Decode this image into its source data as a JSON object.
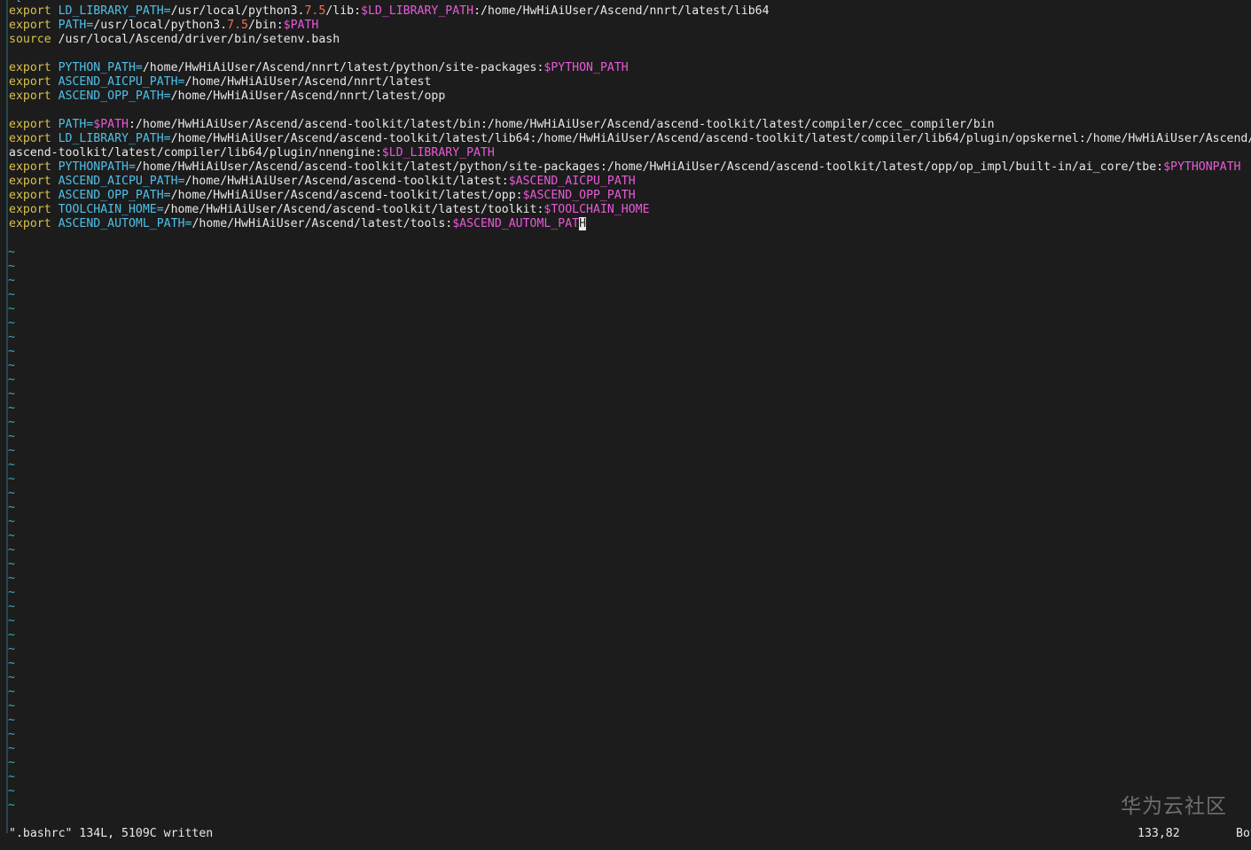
{
  "editor": {
    "lines": [
      [
        {
          "t": "^[",
          "c": "tilde"
        }
      ],
      [
        {
          "t": "export ",
          "c": "kw"
        },
        {
          "t": "LD_LIBRARY_PATH=",
          "c": "var"
        },
        {
          "t": "/usr/local/python3."
        },
        {
          "t": "7.5",
          "c": "num"
        },
        {
          "t": "/lib:"
        },
        {
          "t": "$LD_LIBRARY_PATH",
          "c": "ref"
        },
        {
          "t": ":/home/HwHiAiUser/Ascend/nnrt/latest/lib64"
        }
      ],
      [
        {
          "t": "export ",
          "c": "kw"
        },
        {
          "t": "PATH=",
          "c": "var"
        },
        {
          "t": "/usr/local/python3."
        },
        {
          "t": "7.5",
          "c": "num"
        },
        {
          "t": "/bin:"
        },
        {
          "t": "$PATH",
          "c": "ref"
        }
      ],
      [
        {
          "t": "source ",
          "c": "kw"
        },
        {
          "t": "/usr/local/Ascend/driver/bin/setenv.bash"
        }
      ],
      [],
      [
        {
          "t": "export ",
          "c": "kw"
        },
        {
          "t": "PYTHON_PATH=",
          "c": "var"
        },
        {
          "t": "/home/HwHiAiUser/Ascend/nnrt/latest/python/site-packages:"
        },
        {
          "t": "$PYTHON_PATH",
          "c": "ref"
        }
      ],
      [
        {
          "t": "export ",
          "c": "kw"
        },
        {
          "t": "ASCEND_AICPU_PATH=",
          "c": "var"
        },
        {
          "t": "/home/HwHiAiUser/Ascend/nnrt/latest"
        }
      ],
      [
        {
          "t": "export ",
          "c": "kw"
        },
        {
          "t": "ASCEND_OPP_PATH=",
          "c": "var"
        },
        {
          "t": "/home/HwHiAiUser/Ascend/nnrt/latest/opp"
        }
      ],
      [],
      [
        {
          "t": "export ",
          "c": "kw"
        },
        {
          "t": "PATH=",
          "c": "var"
        },
        {
          "t": "$PATH",
          "c": "ref"
        },
        {
          "t": ":/home/HwHiAiUser/Ascend/ascend-toolkit/latest/bin:/home/HwHiAiUser/Ascend/ascend-toolkit/latest/compiler/ccec_compiler/bin"
        }
      ],
      [
        {
          "t": "export ",
          "c": "kw"
        },
        {
          "t": "LD_LIBRARY_PATH=",
          "c": "var"
        },
        {
          "t": "/home/HwHiAiUser/Ascend/ascend-toolkit/latest/lib64:/home/HwHiAiUser/Ascend/ascend-toolkit/latest/compiler/lib64/plugin/opskernel:/home/HwHiAiUser/Ascend/"
        }
      ],
      [
        {
          "t": "ascend-toolkit/latest/compiler/lib64/plugin/nnengine:"
        },
        {
          "t": "$LD_LIBRARY_PATH",
          "c": "ref"
        }
      ],
      [
        {
          "t": "export ",
          "c": "kw"
        },
        {
          "t": "PYTHONPATH=",
          "c": "var"
        },
        {
          "t": "/home/HwHiAiUser/Ascend/ascend-toolkit/latest/python/site-packages:/home/HwHiAiUser/Ascend/ascend-toolkit/latest/opp/op_impl/built-in/ai_core/tbe:"
        },
        {
          "t": "$PYTHONPATH",
          "c": "ref"
        }
      ],
      [
        {
          "t": "export ",
          "c": "kw"
        },
        {
          "t": "ASCEND_AICPU_PATH=",
          "c": "var"
        },
        {
          "t": "/home/HwHiAiUser/Ascend/ascend-toolkit/latest:"
        },
        {
          "t": "$ASCEND_AICPU_PATH",
          "c": "ref"
        }
      ],
      [
        {
          "t": "export ",
          "c": "kw"
        },
        {
          "t": "ASCEND_OPP_PATH=",
          "c": "var"
        },
        {
          "t": "/home/HwHiAiUser/Ascend/ascend-toolkit/latest/opp:"
        },
        {
          "t": "$ASCEND_OPP_PATH",
          "c": "ref"
        }
      ],
      [
        {
          "t": "export ",
          "c": "kw"
        },
        {
          "t": "TOOLCHAIN_HOME=",
          "c": "var"
        },
        {
          "t": "/home/HwHiAiUser/Ascend/ascend-toolkit/latest/toolkit:"
        },
        {
          "t": "$TOOLCHAIN_HOME",
          "c": "ref"
        }
      ],
      [
        {
          "t": "export ",
          "c": "kw"
        },
        {
          "t": "ASCEND_AUTOML_PATH=",
          "c": "var"
        },
        {
          "t": "/home/HwHiAiUser/Ascend/latest/tools:"
        },
        {
          "t": "$ASCEND_AUTOML_PAT",
          "c": "ref"
        },
        {
          "t": "H",
          "c": "cursor"
        }
      ],
      []
    ],
    "empty_line_marker": "~",
    "empty_line_count": 40
  },
  "status": {
    "message": "\".bashrc\" 134L, 5109C written",
    "position": "133,82",
    "scroll": "Bot"
  },
  "watermark": {
    "text": "华为云社区"
  }
}
